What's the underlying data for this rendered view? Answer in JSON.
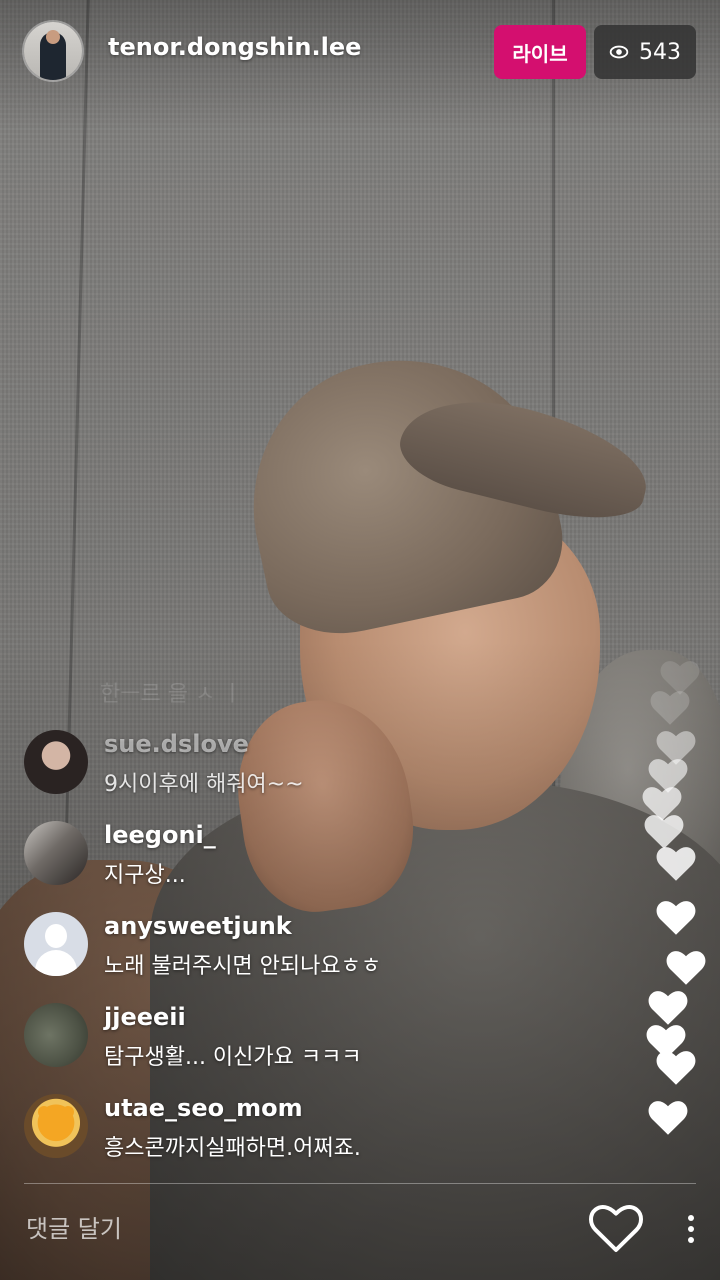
{
  "header": {
    "host_username": "tenor.dongshin.lee",
    "live_label": "라이브",
    "viewer_count": "543"
  },
  "comments": {
    "faded_previous": "한ㅡ르 을 ㅅ ㅣ",
    "items": [
      {
        "username": "sue.dslove",
        "text": "9시이후에 해줘여~~"
      },
      {
        "username": "leegoni_",
        "text": "지구상..."
      },
      {
        "username": "anysweetjunk",
        "text": "노래 불러주시면 안되나요ㅎㅎ"
      },
      {
        "username": "jjeeeii",
        "text": "탐구생활... 이신가요 ㅋㅋㅋ"
      },
      {
        "username": "utae_seo_mom",
        "text": "흥스콘까지실패하면.어쩌죠."
      }
    ]
  },
  "footer": {
    "comment_placeholder": "댓글 달기"
  },
  "colors": {
    "live_badge": "#d40f6f",
    "viewer_badge": "#323232",
    "text": "#ffffff"
  },
  "icons": {
    "eye": "eye-icon",
    "like": "heart-outline-icon",
    "more": "vertical-dots-icon",
    "floating_hearts": "heart-icon"
  }
}
